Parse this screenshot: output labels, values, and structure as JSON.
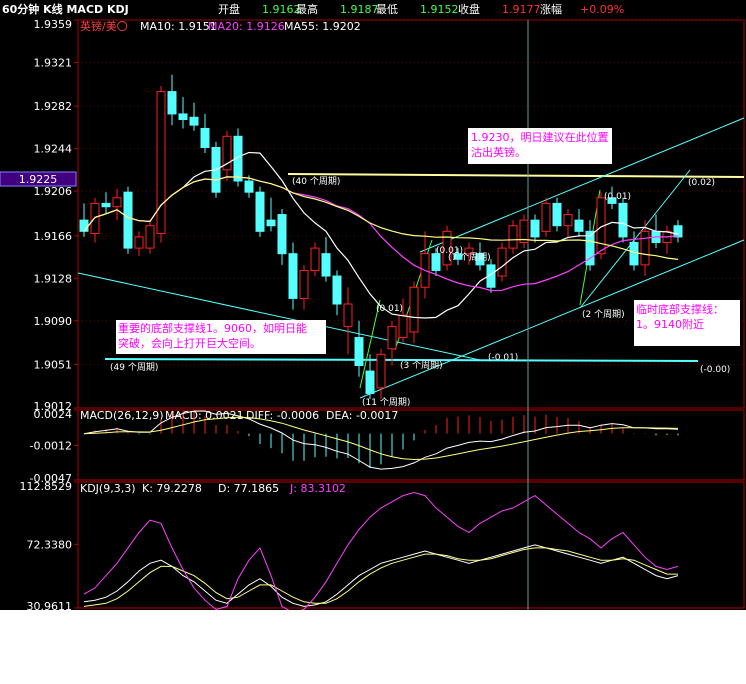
{
  "header": {
    "title": "60分钟 K线 MACD KDJ",
    "fields": [
      {
        "label": "开盘",
        "value": "1.9162"
      },
      {
        "label": "最高",
        "value": "1.9187"
      },
      {
        "label": "最低",
        "value": "1.9152"
      },
      {
        "label": "收盘",
        "value": "1.9177"
      },
      {
        "label": "涨幅",
        "value": "+0.09%"
      }
    ]
  },
  "main_legend": {
    "symbol": "英镑/美〇",
    "ma10": "MA10: 1.9151",
    "ma20": "MA20: 1.9126",
    "ma55": "MA55: 1.9202"
  },
  "macd_legend": {
    "name": "MACD(26,12,9)",
    "macd": "MACD: 0.0021",
    "diff": "DIFF: -0.0006",
    "dea": "DEA: -0.0017"
  },
  "kdj_legend": {
    "name": "KDJ(9,3,3)",
    "k": "K: 79.2278",
    "d": "D: 77.1865",
    "j": "J: 83.3102"
  },
  "current_price_tag": "1.9225",
  "annotations": {
    "note1_line1": "1.9230，明日建议在此位置",
    "note1_line2": "沽出英镑。",
    "note2_line1": "重要的底部支撑线1。9060，如明日能",
    "note2_line2": "突破，会向上打开巨大空间。",
    "note3_line1": "临时底部支撑线：",
    "note3_line2": "1。9140附近",
    "lbl_40": "(40 个周期)",
    "lbl_002": "(0.02)",
    "lbl_001a": "(0.01)",
    "lbl_001b": "(0.01)",
    "lbl_001c": "(0.01)",
    "lbl_49": "(49 个周期)",
    "lbl_3": "(3 个周期)",
    "lbl_m001": "(-0.01)",
    "lbl_m000": "(-0.00)",
    "lbl_2": "(2 个周期)",
    "lbl_11": "(11 个周期)",
    "lbl_7": "(7 个周期)"
  },
  "colors": {
    "up": "#ff2020",
    "down": "#55ffff",
    "ma10": "#ffffff",
    "ma20": "#ff40ff",
    "ma55": "#ffff80",
    "axis": "#b00000",
    "grid": "#600000"
  },
  "chart_data": [
    {
      "type": "candlestick",
      "title": "英镑/美〇",
      "ylim": [
        1.9012,
        1.9359
      ],
      "yticks": [
        "1.9359",
        "1.9321",
        "1.9282",
        "1.9244",
        "1.9206",
        "1.9166",
        "1.9128",
        "1.9090",
        "1.9051",
        "1.9012"
      ],
      "candles": [
        [
          1.918,
          1.9195,
          1.9165,
          1.917
        ],
        [
          1.9168,
          1.92,
          1.916,
          1.9195
        ],
        [
          1.9195,
          1.9205,
          1.9185,
          1.9192
        ],
        [
          1.9192,
          1.9208,
          1.918,
          1.92
        ],
        [
          1.9205,
          1.921,
          1.915,
          1.9155
        ],
        [
          1.9155,
          1.917,
          1.9148,
          1.9165
        ],
        [
          1.9155,
          1.918,
          1.915,
          1.9175
        ],
        [
          1.9168,
          1.93,
          1.916,
          1.9295
        ],
        [
          1.9295,
          1.931,
          1.9265,
          1.9275
        ],
        [
          1.9275,
          1.929,
          1.9262,
          1.927
        ],
        [
          1.9272,
          1.9285,
          1.926,
          1.9265
        ],
        [
          1.9262,
          1.9275,
          1.924,
          1.9245
        ],
        [
          1.9245,
          1.925,
          1.92,
          1.9205
        ],
        [
          1.9225,
          1.926,
          1.9215,
          1.9255
        ],
        [
          1.9255,
          1.9262,
          1.921,
          1.9215
        ],
        [
          1.9215,
          1.922,
          1.92,
          1.9205
        ],
        [
          1.9205,
          1.921,
          1.9165,
          1.917
        ],
        [
          1.918,
          1.92,
          1.917,
          1.9175
        ],
        [
          1.9185,
          1.919,
          1.914,
          1.915
        ],
        [
          1.915,
          1.916,
          1.91,
          1.911
        ],
        [
          1.911,
          1.914,
          1.91,
          1.9135
        ],
        [
          1.9135,
          1.916,
          1.913,
          1.9155
        ],
        [
          1.915,
          1.9165,
          1.9125,
          1.913
        ],
        [
          1.913,
          1.9135,
          1.9095,
          1.9105
        ],
        [
          1.9085,
          1.912,
          1.906,
          1.9105
        ],
        [
          1.9075,
          1.909,
          1.904,
          1.905
        ],
        [
          1.9045,
          1.906,
          1.902,
          1.9025
        ],
        [
          1.903,
          1.9065,
          1.902,
          1.906
        ],
        [
          1.9065,
          1.909,
          1.905,
          1.9085
        ],
        [
          1.9075,
          1.911,
          1.907,
          1.9095
        ],
        [
          1.908,
          1.9125,
          1.907,
          1.912
        ],
        [
          1.912,
          1.917,
          1.911,
          1.915
        ],
        [
          1.915,
          1.9155,
          1.913,
          1.9135
        ],
        [
          1.914,
          1.9175,
          1.9135,
          1.917
        ],
        [
          1.915,
          1.9155,
          1.914,
          1.9145
        ],
        [
          1.915,
          1.916,
          1.914,
          1.9155
        ],
        [
          1.915,
          1.916,
          1.9135,
          1.914
        ],
        [
          1.914,
          1.9145,
          1.9115,
          1.912
        ],
        [
          1.913,
          1.916,
          1.9125,
          1.9155
        ],
        [
          1.9155,
          1.918,
          1.915,
          1.9175
        ],
        [
          1.916,
          1.9185,
          1.9155,
          1.918
        ],
        [
          1.918,
          1.9185,
          1.916,
          1.9165
        ],
        [
          1.917,
          1.92,
          1.9165,
          1.9195
        ],
        [
          1.9195,
          1.92,
          1.917,
          1.9175
        ],
        [
          1.9175,
          1.919,
          1.9165,
          1.9185
        ],
        [
          1.918,
          1.919,
          1.9165,
          1.917
        ],
        [
          1.917,
          1.918,
          1.9135,
          1.914
        ],
        [
          1.915,
          1.9205,
          1.9145,
          1.92
        ],
        [
          1.92,
          1.921,
          1.919,
          1.9195
        ],
        [
          1.9195,
          1.92,
          1.916,
          1.9165
        ],
        [
          1.916,
          1.917,
          1.9135,
          1.914
        ],
        [
          1.914,
          1.918,
          1.913,
          1.917
        ],
        [
          1.917,
          1.9185,
          1.9155,
          1.916
        ],
        [
          1.916,
          1.9175,
          1.915,
          1.917
        ],
        [
          1.9175,
          1.918,
          1.916,
          1.9165
        ]
      ]
    },
    {
      "type": "bar",
      "title": "MACD(26,12,9)",
      "ylim": [
        -0.0047,
        0.0024
      ],
      "yticks": [
        "0.0024",
        "-0.0012",
        "-0.0047"
      ]
    },
    {
      "type": "line",
      "title": "KDJ(9,3,3)",
      "ylim": [
        30.9611,
        112.8529
      ],
      "yticks": [
        "112.8529",
        "72.3380",
        "30.9611"
      ],
      "series": [
        {
          "name": "K",
          "values": [
            35,
            36,
            38,
            42,
            48,
            55,
            60,
            62,
            58,
            52,
            48,
            42,
            36,
            34,
            40,
            46,
            50,
            45,
            38,
            34,
            32,
            33,
            35,
            40,
            46,
            52,
            56,
            60,
            62,
            64,
            66,
            68,
            66,
            64,
            62,
            60,
            62,
            64,
            66,
            68,
            70,
            72,
            70,
            68,
            66,
            64,
            62,
            60,
            62,
            64,
            60,
            56,
            52,
            50,
            52
          ]
        },
        {
          "name": "D",
          "values": [
            32,
            33,
            34,
            37,
            42,
            48,
            54,
            58,
            58,
            55,
            52,
            47,
            41,
            37,
            38,
            42,
            46,
            46,
            42,
            38,
            35,
            34,
            34,
            37,
            42,
            48,
            53,
            57,
            60,
            62,
            64,
            66,
            66,
            65,
            63,
            62,
            62,
            63,
            65,
            67,
            69,
            70,
            70,
            69,
            68,
            66,
            64,
            62,
            62,
            63,
            62,
            59,
            56,
            53,
            53
          ]
        },
        {
          "name": "J",
          "values": [
            40,
            44,
            52,
            60,
            70,
            80,
            88,
            86,
            70,
            56,
            44,
            36,
            30,
            32,
            50,
            62,
            70,
            52,
            32,
            28,
            30,
            38,
            48,
            60,
            72,
            82,
            90,
            96,
            100,
            104,
            106,
            104,
            96,
            90,
            84,
            80,
            86,
            90,
            94,
            96,
            100,
            104,
            98,
            92,
            86,
            80,
            76,
            70,
            76,
            80,
            72,
            64,
            58,
            56,
            58
          ]
        }
      ]
    }
  ]
}
